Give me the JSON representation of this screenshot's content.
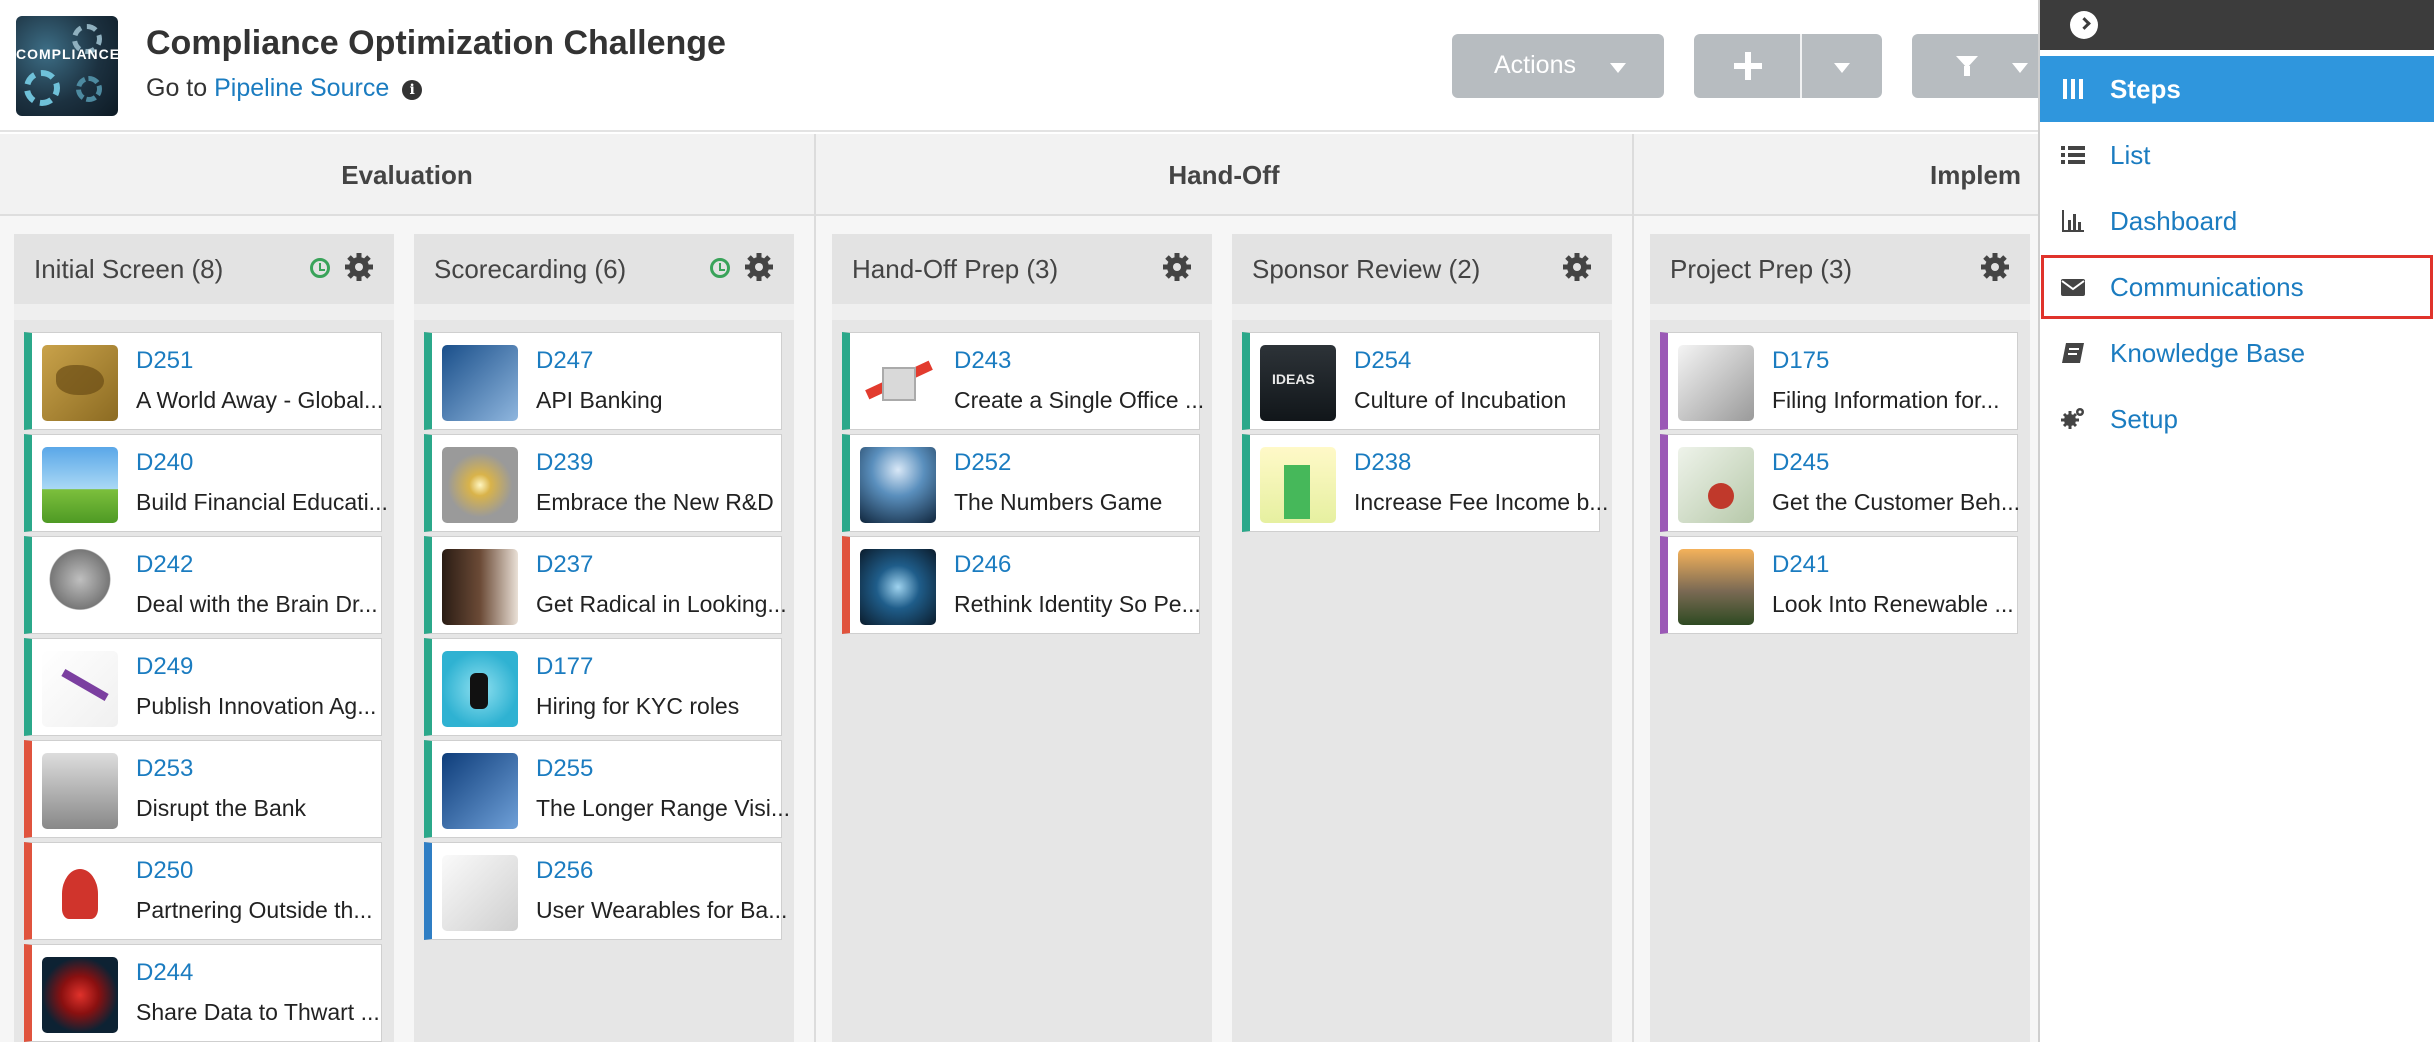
{
  "header": {
    "title": "Compliance Optimization Challenge",
    "subtitle_prefix": "Go to",
    "subtitle_link": "Pipeline Source",
    "logo_text": "COMPLIANCE",
    "actions_label": "Actions"
  },
  "phases": [
    {
      "name": "Evaluation"
    },
    {
      "name": "Hand-Off"
    },
    {
      "name": "Implem"
    }
  ],
  "columns": [
    {
      "title": "Initial Screen (8)",
      "cards": [
        {
          "id": "D251",
          "title": "A World Away - Global..."
        },
        {
          "id": "D240",
          "title": "Build Financial Educati..."
        },
        {
          "id": "D242",
          "title": "Deal with the Brain Dr..."
        },
        {
          "id": "D249",
          "title": "Publish Innovation Ag..."
        },
        {
          "id": "D253",
          "title": "Disrupt the Bank"
        },
        {
          "id": "D250",
          "title": "Partnering Outside th..."
        },
        {
          "id": "D244",
          "title": "Share Data to Thwart ..."
        }
      ]
    },
    {
      "title": "Scorecarding (6)",
      "cards": [
        {
          "id": "D247",
          "title": "API Banking"
        },
        {
          "id": "D239",
          "title": "Embrace the New R&D"
        },
        {
          "id": "D237",
          "title": "Get Radical in Looking..."
        },
        {
          "id": "D177",
          "title": "Hiring for KYC roles"
        },
        {
          "id": "D255",
          "title": "The Longer Range Visi..."
        },
        {
          "id": "D256",
          "title": "User Wearables for Ba..."
        }
      ]
    },
    {
      "title": "Hand-Off Prep (3)",
      "cards": [
        {
          "id": "D243",
          "title": "Create a Single Office ..."
        },
        {
          "id": "D252",
          "title": "The Numbers Game"
        },
        {
          "id": "D246",
          "title": "Rethink Identity So Pe..."
        }
      ]
    },
    {
      "title": "Sponsor Review (2)",
      "cards": [
        {
          "id": "D254",
          "title": "Culture of Incubation"
        },
        {
          "id": "D238",
          "title": "Increase Fee Income b..."
        }
      ]
    },
    {
      "title": "Project Prep (3)",
      "cards": [
        {
          "id": "D175",
          "title": "Filing Information for..."
        },
        {
          "id": "D245",
          "title": "Get the Customer Beh..."
        },
        {
          "id": "D241",
          "title": "Look Into Renewable ..."
        }
      ]
    }
  ],
  "menu": {
    "items": [
      {
        "label": "Steps"
      },
      {
        "label": "List"
      },
      {
        "label": "Dashboard"
      },
      {
        "label": "Communications"
      },
      {
        "label": "Knowledge Base"
      },
      {
        "label": "Setup"
      }
    ]
  },
  "colors": {
    "accent_blue": "#2f96dd",
    "link_blue": "#1b7cc0",
    "card_green": "#2ba88a",
    "card_red": "#e0533d",
    "card_blue": "#2f7ec4",
    "card_purple": "#9b59b6",
    "highlight_red": "#e0332b",
    "button_gray": "#b7bcc0"
  }
}
